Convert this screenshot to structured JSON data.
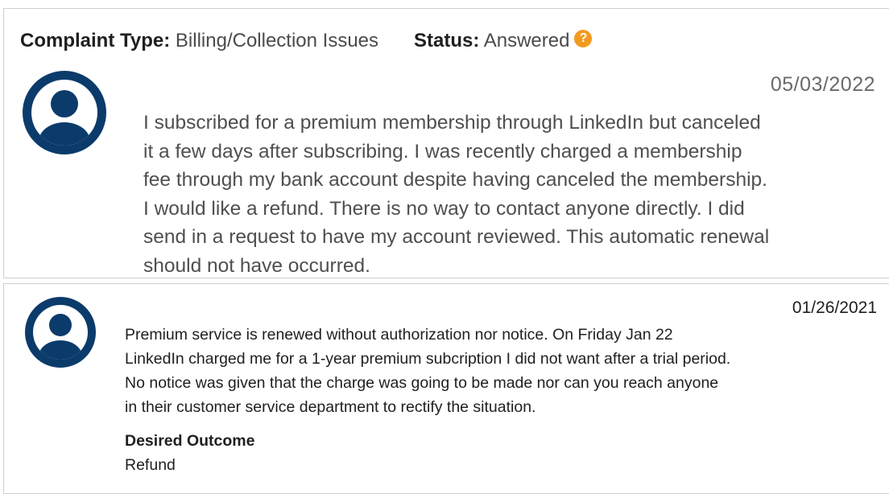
{
  "complaint": {
    "type_label": "Complaint Type:",
    "type_value": "Billing/Collection Issues",
    "status_label": "Status:",
    "status_value": "Answered",
    "help_icon": "?",
    "date": "05/03/2022",
    "text_lines": [
      "I subscribed for a premium membership through LinkedIn but canceled",
      "it a few days after subscribing. I was recently charged a membership",
      "fee through my bank account despite having canceled the membership.",
      "I would like a refund. There is no way to contact anyone directly. I did",
      "send in a request to have my account reviewed. This automatic renewal",
      "should not have occurred."
    ]
  },
  "review": {
    "date": "01/26/2021",
    "text_lines": [
      "Premium service is renewed without authorization nor notice. On Friday Jan 22",
      "LinkedIn charged me for a 1-year premium subcription I did not want after a trial period.",
      "No notice was given that the charge was going to be made nor can you reach anyone",
      "in their customer service department to rectify the situation."
    ],
    "desired_outcome_label": "Desired Outcome",
    "desired_outcome_value": "Refund"
  },
  "icons": {
    "avatar": "user-avatar-icon",
    "help": "question-circle-icon"
  },
  "colors": {
    "avatar": "#0b3b6b",
    "help_badge": "#f39a1e",
    "muted_text": "#4f4f4f",
    "dark_text": "#1f1f1f"
  }
}
